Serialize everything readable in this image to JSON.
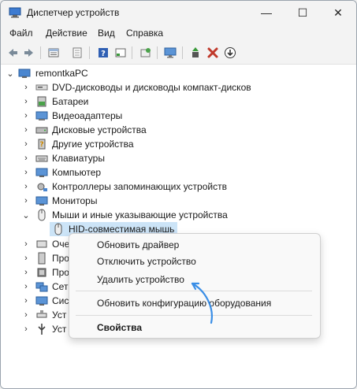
{
  "window": {
    "title": "Диспетчер устройств",
    "minimize": "—",
    "maximize": "☐",
    "close": "✕"
  },
  "menu": {
    "file": "Файл",
    "action": "Действие",
    "view": "Вид",
    "help": "Справка"
  },
  "toolbar": {
    "icons": [
      "back-icon",
      "forward-icon",
      "properties-icon",
      "show-hidden-icon",
      "help-icon",
      "details-icon",
      "scan-hardware-icon",
      "monitor-icon",
      "add-driver-icon",
      "remove-icon",
      "update-icon"
    ]
  },
  "tree": {
    "root": "remontkaPC",
    "items": [
      {
        "label": "DVD-дисководы и дисководы компакт-дисков",
        "icon": "dvd-icon",
        "expanded": false
      },
      {
        "label": "Батареи",
        "icon": "battery-icon",
        "expanded": false
      },
      {
        "label": "Видеоадаптеры",
        "icon": "display-adapter-icon",
        "expanded": false
      },
      {
        "label": "Дисковые устройства",
        "icon": "disk-drive-icon",
        "expanded": false
      },
      {
        "label": "Другие устройства",
        "icon": "other-devices-icon",
        "expanded": false
      },
      {
        "label": "Клавиатуры",
        "icon": "keyboard-icon",
        "expanded": false
      },
      {
        "label": "Компьютер",
        "icon": "computer-icon",
        "expanded": false
      },
      {
        "label": "Контроллеры запоминающих устройств",
        "icon": "storage-controller-icon",
        "expanded": false
      },
      {
        "label": "Мониторы",
        "icon": "monitor-icon",
        "expanded": false
      },
      {
        "label": "Мыши и иные указывающие устройства",
        "icon": "mouse-icon",
        "expanded": true
      }
    ],
    "child": "HID-совместимая мышь",
    "partial": [
      {
        "label": "Оче",
        "icon": "queue-icon"
      },
      {
        "label": "Про",
        "icon": "software-icon"
      },
      {
        "label": "Про",
        "icon": "processor-icon"
      },
      {
        "label": "Сет",
        "icon": "network-icon"
      },
      {
        "label": "Сис",
        "icon": "system-icon"
      },
      {
        "label": "Уст",
        "icon": "hid-icon"
      },
      {
        "label": "Уст",
        "icon": "usb-icon"
      }
    ]
  },
  "context_menu": {
    "update_driver": "Обновить драйвер",
    "disable_device": "Отключить устройство",
    "uninstall_device": "Удалить устройство",
    "scan_hardware": "Обновить конфигурацию оборудования",
    "properties": "Свойства"
  },
  "colors": {
    "selection": "#cce4f7",
    "arrow": "#3a8ee6",
    "remove_icon": "#c0392b"
  }
}
